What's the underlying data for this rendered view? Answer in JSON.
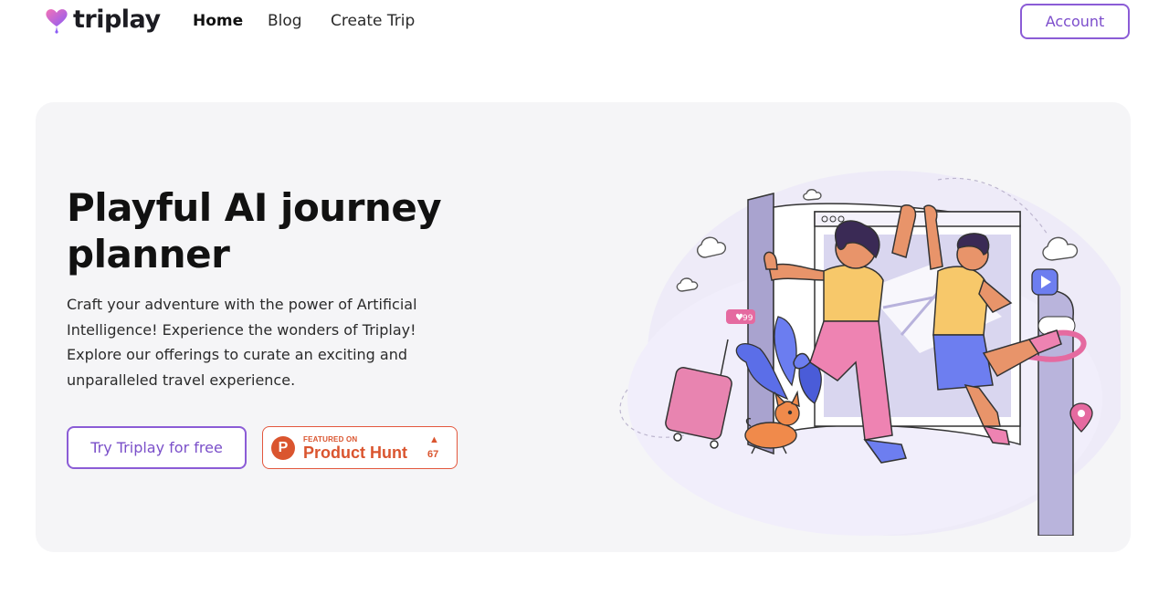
{
  "nav": {
    "logo_text": "triplay",
    "links": [
      {
        "label": "Home",
        "active": true
      },
      {
        "label": "Blog",
        "active": false
      },
      {
        "label": "Create Trip",
        "active": false
      }
    ],
    "account_label": "Account"
  },
  "hero": {
    "title": "Playful AI journey planner",
    "description": "Craft your adventure with the power of Artificial Intelligence! Experience the wonders of Triplay! Explore our offerings to curate an exciting and unparalleled travel experience.",
    "cta_label": "Try Triplay for free",
    "product_hunt": {
      "small_text": "FEATURED ON",
      "big_text": "Product Hunt",
      "logo_letter": "P",
      "upvotes": "67"
    },
    "illustration": {
      "like_count": "99"
    }
  },
  "colors": {
    "accent": "#8b5cd6",
    "hero_bg": "#f5f5f7",
    "product_hunt": "#da552f"
  }
}
